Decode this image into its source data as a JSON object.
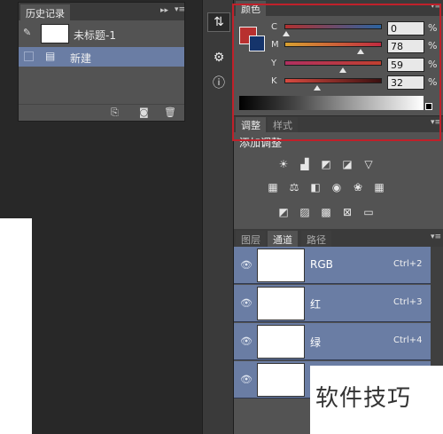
{
  "history": {
    "tab_label": "历史记录",
    "snapshot_label": "未标题-1",
    "state_label": "新建"
  },
  "color": {
    "tab_label": "颜色",
    "fg_color": "#b8302f",
    "bg_color": "#15346b",
    "sliders": [
      {
        "label": "C",
        "value": "0",
        "unit": "%"
      },
      {
        "label": "M",
        "value": "78",
        "unit": "%"
      },
      {
        "label": "Y",
        "value": "59",
        "unit": "%"
      },
      {
        "label": "K",
        "value": "32",
        "unit": "%"
      }
    ]
  },
  "adjustments": {
    "tab_label": "调整",
    "tab2_label": "样式",
    "title": "添加调整"
  },
  "layers": {
    "tabs": [
      "图层",
      "通道",
      "路径"
    ],
    "channels": [
      {
        "name": "RGB",
        "shortcut": "Ctrl+2"
      },
      {
        "name": "红",
        "shortcut": "Ctrl+3"
      },
      {
        "name": "绿",
        "shortcut": "Ctrl+4"
      },
      {
        "name": "",
        "shortcut": ""
      }
    ]
  },
  "watermark": "软件技巧",
  "icons": {
    "history_brush": "brush-icon",
    "new_doc": "new-doc-icon",
    "camera": "camera-icon",
    "trash": "trash-icon",
    "eye": "eye-icon"
  }
}
